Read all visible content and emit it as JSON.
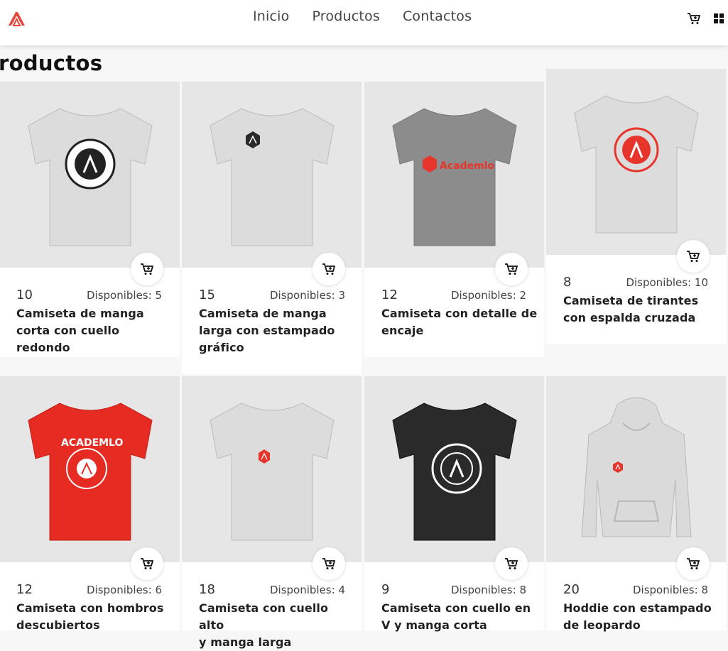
{
  "nav": {
    "links": [
      "Inicio",
      "Productos",
      "Contactos"
    ],
    "brand_color": "#e8453c"
  },
  "page_title": "roductos",
  "products": [
    {
      "qty": "10",
      "available": "Disponibles: 5",
      "name_lines": [
        "Camiseta de manga",
        "corta con cuello redondo"
      ],
      "shirt_color": "#dcdcdc",
      "print": "white-circle-badge"
    },
    {
      "qty": "15",
      "available": "Disponibles: 3",
      "name_lines": [
        "Camiseta de manga",
        "larga con estampado",
        "gráfico"
      ],
      "shirt_color": "#dcdcdc",
      "print": "small-dark-badge"
    },
    {
      "qty": "12",
      "available": "Disponibles: 2",
      "name_lines": [
        "Camiseta con detalle de",
        "encaje"
      ],
      "shirt_color": "#8c8c8c",
      "print": "academlo-wordmark",
      "logo_text": "Academlo"
    },
    {
      "qty": "8",
      "available": "Disponibles: 10",
      "name_lines": [
        "Camiseta de tirantes",
        "con espalda cruzada"
      ],
      "shirt_color": "#dcdcdc",
      "print": "red-circle-badge"
    },
    {
      "qty": "12",
      "available": "Disponibles: 6",
      "name_lines": [
        "Camiseta con hombros",
        "descubiertos"
      ],
      "shirt_color": "#e52b22",
      "print": "white-badge-on-red",
      "logo_text": "ACADEMLO"
    },
    {
      "qty": "18",
      "available": "Disponibles: 4",
      "name_lines": [
        "Camiseta con cuello alto",
        "y manga larga"
      ],
      "shirt_color": "#dcdcdc",
      "print": "small-red-badge"
    },
    {
      "qty": "9",
      "available": "Disponibles: 8",
      "name_lines": [
        "Camiseta con cuello en",
        "V y manga corta"
      ],
      "shirt_color": "#2a2a2a",
      "print": "white-outline-badge"
    },
    {
      "qty": "20",
      "available": "Disponibles: 8",
      "name_lines": [
        "Hoddie con estampado",
        "de leopardo"
      ],
      "shirt_color": "#dadada",
      "print": "hoodie-small-red-badge"
    }
  ]
}
